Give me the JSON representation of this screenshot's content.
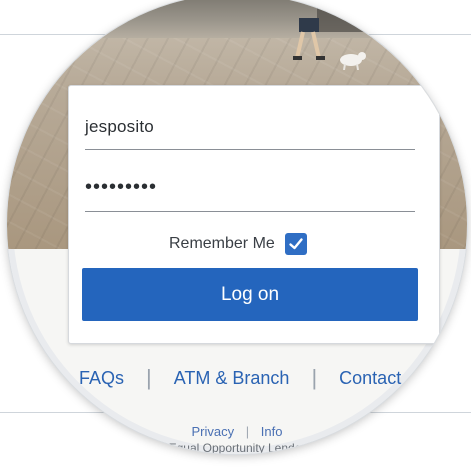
{
  "login": {
    "username_value": "jesposito",
    "password_value": "•••••••••",
    "remember_label": "Remember Me",
    "remember_checked": true,
    "logon_label": "Log on"
  },
  "links": {
    "faqs": "FAQs",
    "atm_branch": "ATM & Branch",
    "contact": "Contact",
    "separator": "|"
  },
  "footer": {
    "privacy": "Privacy",
    "info": "Info",
    "separator": "|",
    "equal_opportunity": "Equal Opportunity Lender"
  },
  "colors": {
    "primary_button": "#2465bd",
    "link": "#2a63b3",
    "checkbox": "#2f6ec4"
  },
  "icons": {
    "checkbox": "checkmark-icon"
  }
}
